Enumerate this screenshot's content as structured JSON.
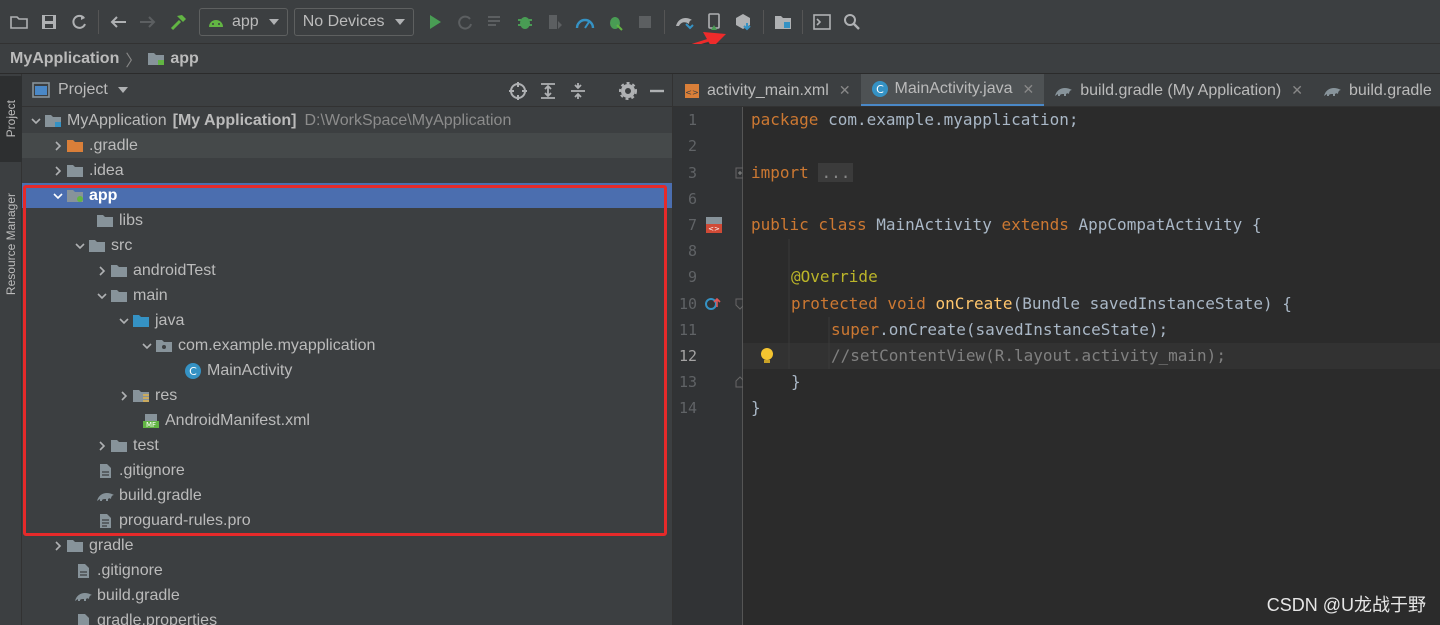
{
  "toolbar": {
    "run_config": "app",
    "device": "No Devices"
  },
  "breadcrumb": {
    "root": "MyApplication",
    "module": "app"
  },
  "side_tabs": {
    "project": "Project",
    "resource_manager": "Resource Manager"
  },
  "project_panel": {
    "title": "Project"
  },
  "tree": [
    {
      "label": "MyApplication",
      "bold": "[My Application]",
      "path": "D:\\WorkSpace\\MyApplication"
    },
    {
      "label": ".gradle"
    },
    {
      "label": ".idea"
    },
    {
      "label": "app"
    },
    {
      "label": "libs"
    },
    {
      "label": "src"
    },
    {
      "label": "androidTest"
    },
    {
      "label": "main"
    },
    {
      "label": "java"
    },
    {
      "label": "com.example.myapplication"
    },
    {
      "label": "MainActivity"
    },
    {
      "label": "res"
    },
    {
      "label": "AndroidManifest.xml"
    },
    {
      "label": "test"
    },
    {
      "label": ".gitignore"
    },
    {
      "label": "build.gradle"
    },
    {
      "label": "proguard-rules.pro"
    },
    {
      "label": "gradle"
    },
    {
      "label": ".gitignore"
    },
    {
      "label": "build.gradle"
    },
    {
      "label": "gradle.properties"
    }
  ],
  "editor_tabs": [
    {
      "label": "activity_main.xml"
    },
    {
      "label": "MainActivity.java"
    },
    {
      "label": "build.gradle (My Application)"
    },
    {
      "label": "build.gradle"
    }
  ],
  "line_numbers": [
    "1",
    "2",
    "3",
    "6",
    "7",
    "8",
    "9",
    "10",
    "11",
    "12",
    "13",
    "14"
  ],
  "code": {
    "l1_kw": "package",
    "l1_rest": " com.example.myapplication;",
    "l3_kw": "import",
    "l3_fold": "...",
    "l7_kw1": "public class",
    "l7_mid": " MainActivity ",
    "l7_kw2": "extends",
    "l7_rest": " AppCompatActivity {",
    "l9_ann": "@Override",
    "l10_kw": "protected void",
    "l10_fn": "onCreate",
    "l10_rest": "(Bundle savedInstanceState) {",
    "l11_kw": "super",
    "l11_rest": ".onCreate(savedInstanceState);",
    "l12_comment": "//setContentView(R.layout.activity_main);",
    "l13": "}",
    "l14": "}"
  },
  "watermark": "CSDN @U龙战于野",
  "colors": {
    "accent_selection": "#4b6eaf",
    "highlight_box": "#e62a2a",
    "keyword": "#cc7832",
    "annotation": "#bbb529",
    "function": "#ffc66d",
    "comment": "#808080"
  },
  "icons": [
    "open-folder-icon",
    "save-icon",
    "sync-icon",
    "back-icon",
    "forward-icon",
    "build-hammer-icon",
    "android-icon",
    "run-icon",
    "rerun-icon",
    "apply-changes-icon",
    "debug-icon",
    "attach-debugger-icon",
    "profile-icon",
    "run-with-coverage-icon",
    "stop-icon",
    "gradle-sync-icon",
    "avd-manager-icon",
    "sdk-manager-icon",
    "project-structure-icon",
    "terminal-icon",
    "search-icon"
  ]
}
